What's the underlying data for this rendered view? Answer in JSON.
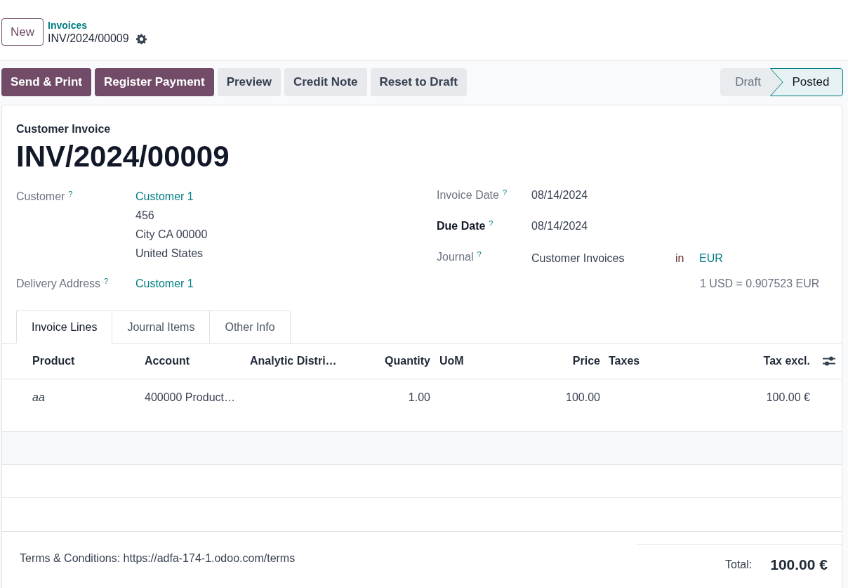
{
  "new_button": "New",
  "breadcrumb": {
    "parent": "Invoices",
    "current": "INV/2024/00009"
  },
  "actions": [
    {
      "label": "Send & Print",
      "kind": "primary"
    },
    {
      "label": "Register Payment",
      "kind": "primary"
    },
    {
      "label": "Preview",
      "kind": "secondary"
    },
    {
      "label": "Credit Note",
      "kind": "secondary"
    },
    {
      "label": "Reset to Draft",
      "kind": "secondary"
    }
  ],
  "statusbar": [
    {
      "label": "Draft",
      "selected": false
    },
    {
      "label": "Posted",
      "selected": true
    }
  ],
  "sheet": {
    "type_label": "Customer Invoice",
    "title": "INV/2024/00009",
    "left_fields": [
      {
        "label": "Customer",
        "help": "?",
        "bold": false,
        "values": [
          {
            "text": "Customer 1",
            "kind": "link"
          },
          {
            "text": "456",
            "kind": "plain"
          },
          {
            "text": "City CA 00000",
            "kind": "plain"
          },
          {
            "text": "United States",
            "kind": "plain"
          }
        ]
      },
      {
        "label": "Delivery Address",
        "help": "?",
        "bold": false,
        "values": [
          {
            "text": "Customer 1",
            "kind": "link"
          }
        ]
      }
    ],
    "right_fields": [
      {
        "label": "Invoice Date",
        "help": "?",
        "bold": false,
        "value": "08/14/2024"
      },
      {
        "label": "Due Date",
        "help": "?",
        "bold": true,
        "value": "08/14/2024"
      },
      {
        "label": "Journal",
        "help": "?",
        "bold": false,
        "value": "Customer Invoices",
        "connector": "in",
        "currency": "EUR"
      }
    ],
    "rate": "1 USD = 0.907523 EUR"
  },
  "tabs": [
    {
      "label": "Invoice Lines",
      "selected": true
    },
    {
      "label": "Journal Items",
      "selected": false
    },
    {
      "label": "Other Info",
      "selected": false
    }
  ],
  "table": {
    "columns": [
      "Product",
      "Account",
      "Analytic Distri…",
      "Quantity",
      "UoM",
      "Price",
      "Taxes",
      "Tax excl."
    ],
    "rows": [
      {
        "product": "aa",
        "account": "400000 Product…",
        "quantity": "1.00",
        "price": "100.00",
        "tax_excl": "100.00 €"
      }
    ]
  },
  "terms": "Terms & Conditions: https://adfa-174-1.odoo.com/terms",
  "total": {
    "label": "Total:",
    "value": "100.00 €"
  }
}
